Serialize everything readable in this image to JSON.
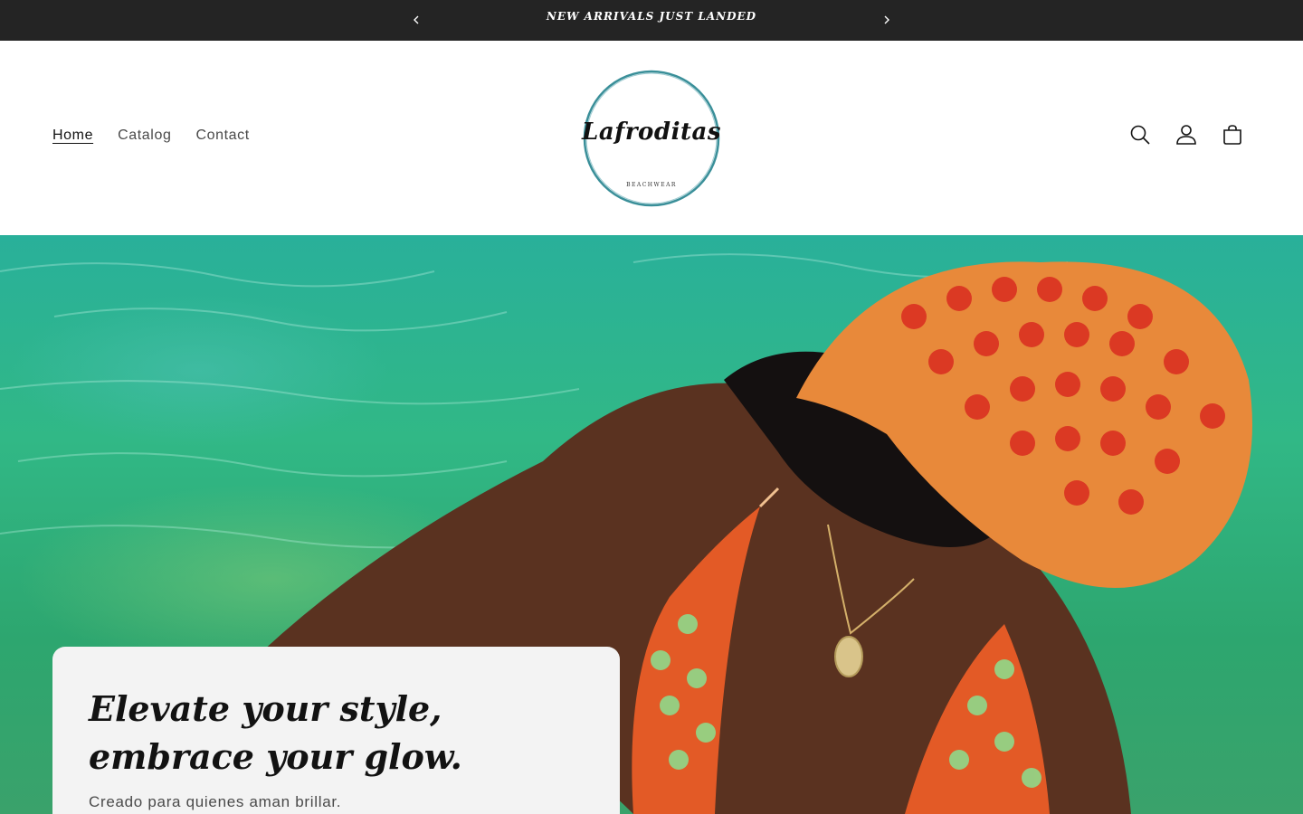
{
  "announcement": {
    "message": "NEW ARRIVALS JUST LANDED"
  },
  "header": {
    "nav": [
      {
        "label": "Home",
        "active": true
      },
      {
        "label": "Catalog",
        "active": false
      },
      {
        "label": "Contact",
        "active": false
      }
    ],
    "logo": {
      "name": "Lafroditas",
      "tagline": "BEACHWEAR"
    },
    "icons": [
      "search-icon",
      "account-icon",
      "cart-icon"
    ]
  },
  "hero": {
    "heading": "Elevate your style, embrace your glow.",
    "subtext": "Creado para quienes aman brillar."
  },
  "colors": {
    "announcement_bg": "#242424",
    "card_bg": "#f3f3f3",
    "logo_ring": "#3a8f99"
  }
}
